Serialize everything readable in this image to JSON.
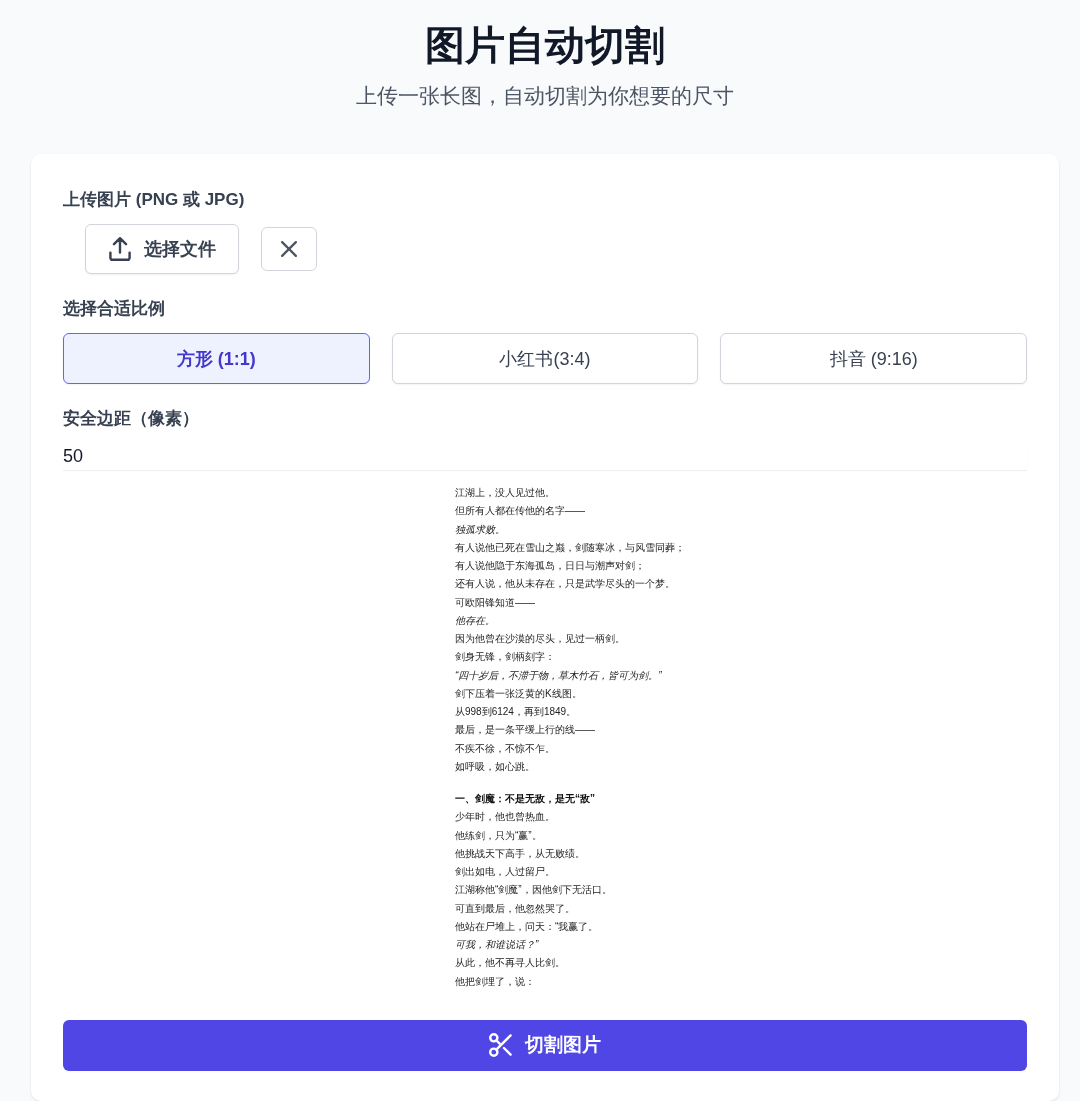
{
  "header": {
    "title": "图片自动切割",
    "subtitle": "上传一张长图，自动切割为你想要的尺寸"
  },
  "upload": {
    "label": "上传图片 (PNG 或 JPG)",
    "choose_button": "选择文件"
  },
  "ratio": {
    "label": "选择合适比例",
    "options": [
      {
        "label": "方形 (1:1)",
        "selected": true
      },
      {
        "label": "小红书(3:4)",
        "selected": false
      },
      {
        "label": "抖音 (9:16)",
        "selected": false
      }
    ]
  },
  "margin": {
    "label": "安全边距（像素）",
    "value": "50"
  },
  "preview": {
    "sections": [
      {
        "lines": [
          {
            "text": "江湖上，没人见过他。",
            "italic": false
          },
          {
            "text": "但所有人都在传他的名字——",
            "italic": false
          },
          {
            "text": "独孤求败。",
            "italic": true
          },
          {
            "text": "有人说他已死在雪山之巅，剑随寒冰，与风雪同葬；",
            "italic": false
          },
          {
            "text": "有人说他隐于东海孤岛，日日与潮声对剑；",
            "italic": false
          },
          {
            "text": "还有人说，他从未存在，只是武学尽头的一个梦。",
            "italic": false
          },
          {
            "text": "可欧阳锋知道——",
            "italic": false
          },
          {
            "text": "他存在。",
            "italic": true
          },
          {
            "text": "因为他曾在沙漠的尽头，见过一柄剑。",
            "italic": false
          },
          {
            "text": "剑身无锋，剑柄刻字：",
            "italic": false
          },
          {
            "text": "“四十岁后，不滞于物，草木竹石，皆可为剑。”",
            "italic": true
          },
          {
            "text": "剑下压着一张泛黄的K线图。",
            "italic": false
          },
          {
            "text": "从998到6124，再到1849。",
            "italic": false
          },
          {
            "text": "最后，是一条平缓上行的线——",
            "italic": false
          },
          {
            "text": "不疾不徐，不惊不乍。",
            "italic": false
          },
          {
            "text": "如呼吸，如心跳。",
            "italic": false
          }
        ]
      },
      {
        "heading": "一、剑魔：不是无敌，是无“敌”",
        "lines": [
          {
            "text": "少年时，他也曾热血。",
            "italic": false
          },
          {
            "text": "他练剑，只为“赢”。",
            "italic": false
          },
          {
            "text": "他挑战天下高手，从无败绩。",
            "italic": false
          },
          {
            "text": "剑出如电，人过留尸。",
            "italic": false
          },
          {
            "text": "江湖称他“剑魔”，因他剑下无活口。",
            "italic": false
          },
          {
            "text": "可直到最后，他忽然哭了。",
            "italic": false
          },
          {
            "text": "他站在尸堆上，问天：“我赢了。",
            "italic": false
          },
          {
            "text": "可我，和谁说话？”",
            "italic": true
          },
          {
            "text": "从此，他不再寻人比剑。",
            "italic": false
          },
          {
            "text": "他把剑埋了，说：",
            "italic": false
          }
        ]
      }
    ]
  },
  "submit_button": {
    "label": "切割图片"
  }
}
